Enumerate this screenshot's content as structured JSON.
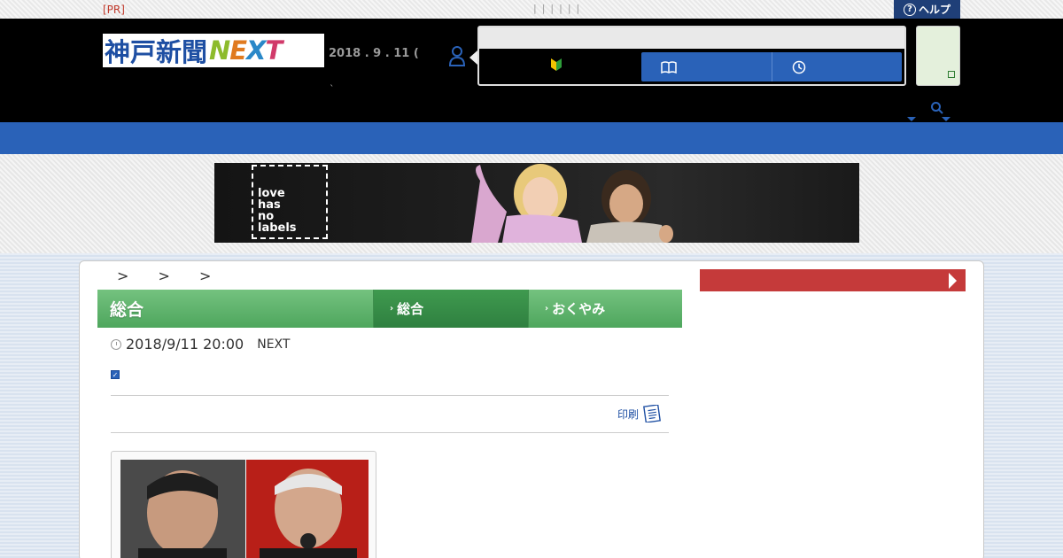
{
  "topbar": {
    "pr_label": "[PR]",
    "help_label": "ヘルプ",
    "help_icon": "question-circle-icon"
  },
  "header": {
    "logo_kanji": "神戸新聞",
    "logo_next": [
      "N",
      "E",
      "X",
      "T"
    ],
    "date": "2018 . 9 . 11 (",
    "backtick": "`"
  },
  "banner": {
    "text_lines": [
      "love",
      "has",
      "no",
      "labels"
    ]
  },
  "breadcrumb": ">  >  >",
  "section": {
    "title": "総合",
    "tab_active": "総合",
    "tab_other": "おくやみ"
  },
  "article": {
    "datetime": "2018/9/11 20:00",
    "source": "NEXT",
    "print_label": "印刷"
  },
  "colors": {
    "brand_blue": "#2a62b8",
    "green": "#4ea65d",
    "red": "#c53a3a"
  }
}
